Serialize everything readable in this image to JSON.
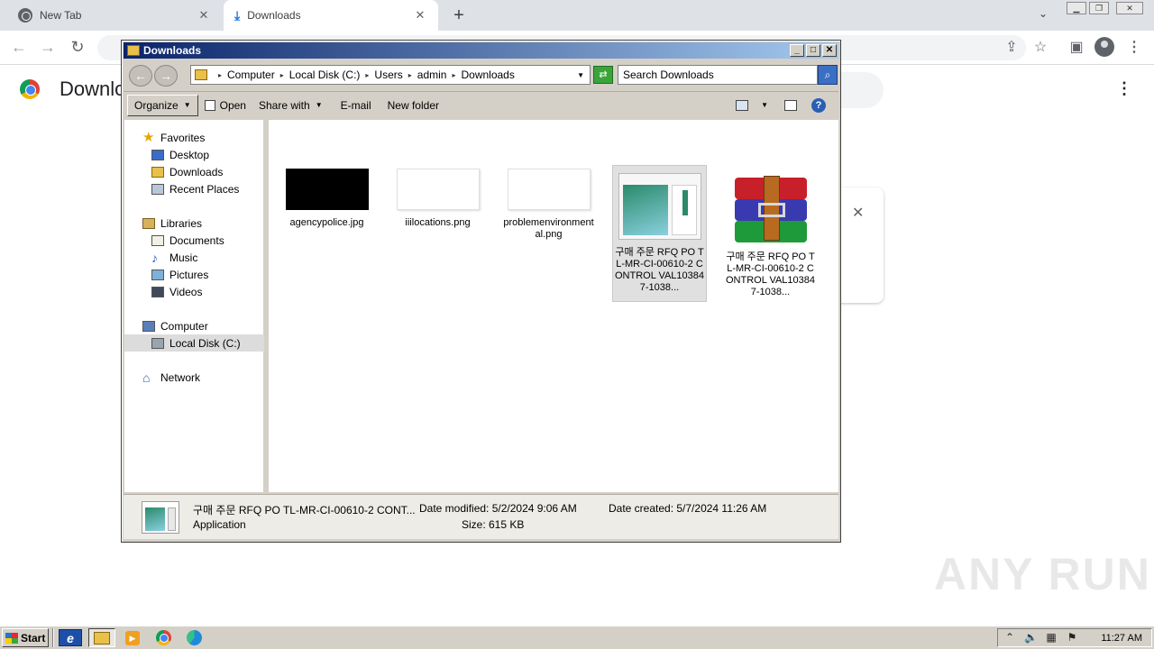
{
  "browser": {
    "tabs": [
      {
        "title": "New Tab"
      },
      {
        "title": "Downloads"
      }
    ],
    "page_title": "Downlo"
  },
  "explorer": {
    "title": "Downloads",
    "breadcrumb": [
      "Computer",
      "Local Disk (C:)",
      "Users",
      "admin",
      "Downloads"
    ],
    "search_placeholder": "Search Downloads",
    "toolbar": {
      "organize": "Organize",
      "open": "Open",
      "share_with": "Share with",
      "email": "E-mail",
      "new_folder": "New folder"
    },
    "nav": {
      "favorites": "Favorites",
      "desktop": "Desktop",
      "downloads": "Downloads",
      "recent_places": "Recent Places",
      "libraries": "Libraries",
      "documents": "Documents",
      "music": "Music",
      "pictures": "Pictures",
      "videos": "Videos",
      "computer": "Computer",
      "local_disk": "Local Disk (C:)",
      "network": "Network"
    },
    "files": [
      {
        "name": "agencypolice.jpg"
      },
      {
        "name": "iiilocations.png"
      },
      {
        "name": "problemenvironmental.png"
      },
      {
        "name": "구매 주문 RFQ PO TL-MR-CI-00610-2 CONTROL VAL103847-1038..."
      },
      {
        "name": "구매 주문 RFQ PO TL-MR-CI-00610-2 CONTROL VAL103847-1038..."
      }
    ],
    "details": {
      "name": "구매 주문 RFQ PO TL-MR-CI-00610-2 CONT...",
      "type": "Application",
      "date_modified": "Date modified: 5/2/2024 9:06 AM",
      "size": "Size: 615 KB",
      "date_created": "Date created: 5/7/2024 11:26 AM"
    }
  },
  "taskbar": {
    "start": "Start",
    "clock": "11:27 AM"
  },
  "watermark": "ANY RUN"
}
